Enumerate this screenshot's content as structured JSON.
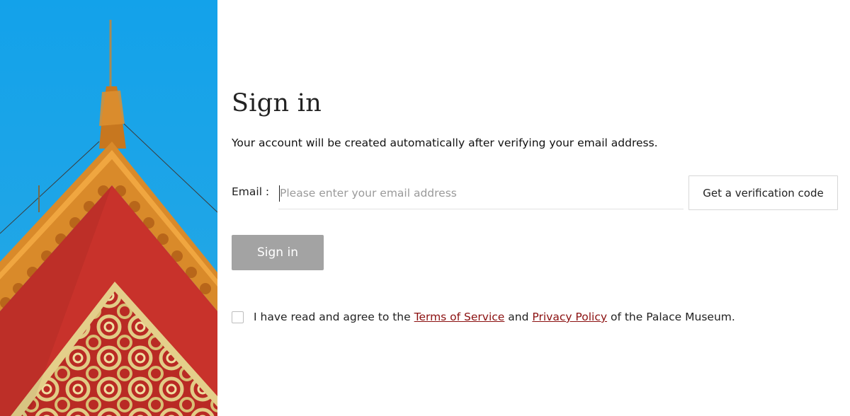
{
  "login": {
    "title": "Sign in",
    "subtitle": "Your account will be created automatically after verifying your email address.",
    "email_label": "Email :",
    "email_placeholder": "Please enter your email address",
    "email_value": "",
    "verify_button": "Get a verification code",
    "signin_button": "Sign in"
  },
  "agreement": {
    "checked": false,
    "prefix": "I have read and agree to the",
    "terms_link": "Terms of Service",
    "conjunction": "and",
    "privacy_link": "Privacy Policy",
    "suffix": "of the Palace Museum."
  },
  "colors": {
    "link": "#8b1010",
    "signin_button_bg": "#a3a3a3",
    "sky": "#1aa3e6",
    "wall_red": "#c8322b",
    "roof_tile": "#d98a2a",
    "gold_ornament": "#d8c27a"
  },
  "hero_image": {
    "icon": "palace-roof-illustration"
  }
}
